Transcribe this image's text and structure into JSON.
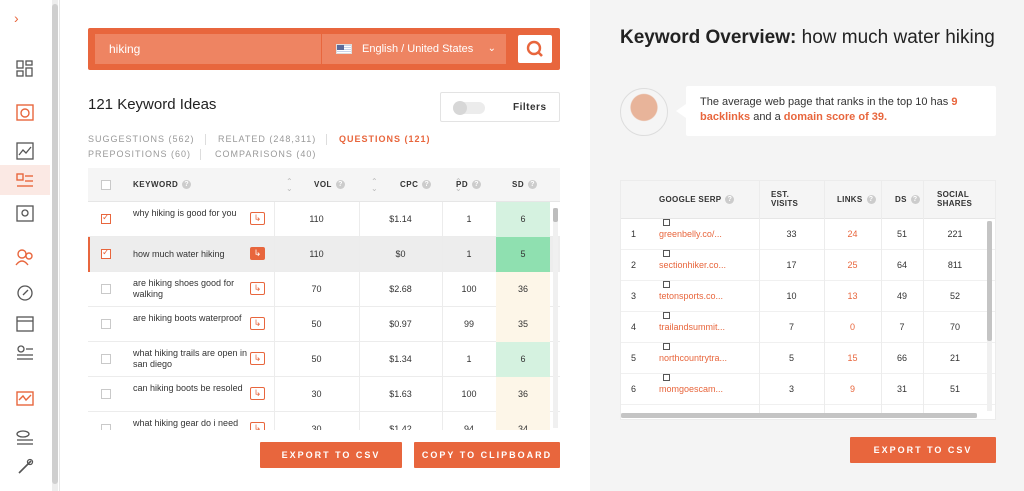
{
  "search": {
    "query": "hiking",
    "locale": "English / United States"
  },
  "keywords": {
    "title": "121 Keyword Ideas",
    "filters_label": "Filters",
    "tabs": [
      {
        "label": "SUGGESTIONS (562)"
      },
      {
        "label": "RELATED (248,311)"
      },
      {
        "label": "QUESTIONS (121)"
      },
      {
        "label": "PREPOSITIONS (60)"
      },
      {
        "label": "COMPARISONS (40)"
      }
    ],
    "columns": {
      "keyword": "KEYWORD",
      "vol": "VOL",
      "cpc": "CPC",
      "pd": "PD",
      "sd": "SD"
    },
    "rows": [
      {
        "keyword": "why hiking is good for you",
        "vol": "110",
        "cpc": "$1.14",
        "pd": "1",
        "sd": "6",
        "checked": true
      },
      {
        "keyword": "how much water hiking",
        "vol": "110",
        "cpc": "$0",
        "pd": "1",
        "sd": "5",
        "checked": true
      },
      {
        "keyword": "are hiking shoes good for walking",
        "vol": "70",
        "cpc": "$2.68",
        "pd": "100",
        "sd": "36",
        "checked": false
      },
      {
        "keyword": "are hiking boots waterproof",
        "vol": "50",
        "cpc": "$0.97",
        "pd": "99",
        "sd": "35",
        "checked": false
      },
      {
        "keyword": "what hiking trails are open in san diego",
        "vol": "50",
        "cpc": "$1.34",
        "pd": "1",
        "sd": "6",
        "checked": false
      },
      {
        "keyword": "can hiking boots be resoled",
        "vol": "30",
        "cpc": "$1.63",
        "pd": "100",
        "sd": "36",
        "checked": false
      },
      {
        "keyword": "what hiking gear do i need",
        "vol": "30",
        "cpc": "$1.42",
        "pd": "94",
        "sd": "34",
        "checked": false
      }
    ],
    "export_label": "EXPORT TO CSV",
    "copy_label": "COPY TO CLIPBOARD"
  },
  "overview": {
    "title_bold": "Keyword Overview:",
    "title_rest": " how much water hiking",
    "callout": {
      "text1": "The average web page that ranks in the top 10 has ",
      "backlinks": "9 backlinks",
      "text2": " and a ",
      "domain_score": "domain score of 39",
      "text3": "."
    },
    "columns": {
      "serp": "GOOGLE SERP",
      "visits1": "EST.",
      "visits2": "VISITS",
      "links": "LINKS",
      "ds": "DS",
      "shares1": "SOCIAL",
      "shares2": "SHARES"
    },
    "rows": [
      {
        "rank": "1",
        "url": "greenbelly.co/...",
        "visits": "33",
        "links": "24",
        "ds": "51",
        "shares": "221"
      },
      {
        "rank": "2",
        "url": "sectionhiker.co...",
        "visits": "17",
        "links": "25",
        "ds": "64",
        "shares": "811"
      },
      {
        "rank": "3",
        "url": "tetonsports.co...",
        "visits": "10",
        "links": "13",
        "ds": "49",
        "shares": "52"
      },
      {
        "rank": "4",
        "url": "trailandsummit...",
        "visits": "7",
        "links": "0",
        "ds": "7",
        "shares": "70"
      },
      {
        "rank": "5",
        "url": "northcountrytra...",
        "visits": "5",
        "links": "15",
        "ds": "66",
        "shares": "21"
      },
      {
        "rank": "6",
        "url": "momgoescam...",
        "visits": "3",
        "links": "9",
        "ds": "31",
        "shares": "51"
      }
    ],
    "export_label": "EXPORT TO CSV"
  },
  "colors": {
    "accent": "#e8663d",
    "sd_green": "#d5f2e0",
    "sd_green_strong": "#8fe0b0",
    "sd_cream": "#fdf6e8"
  }
}
